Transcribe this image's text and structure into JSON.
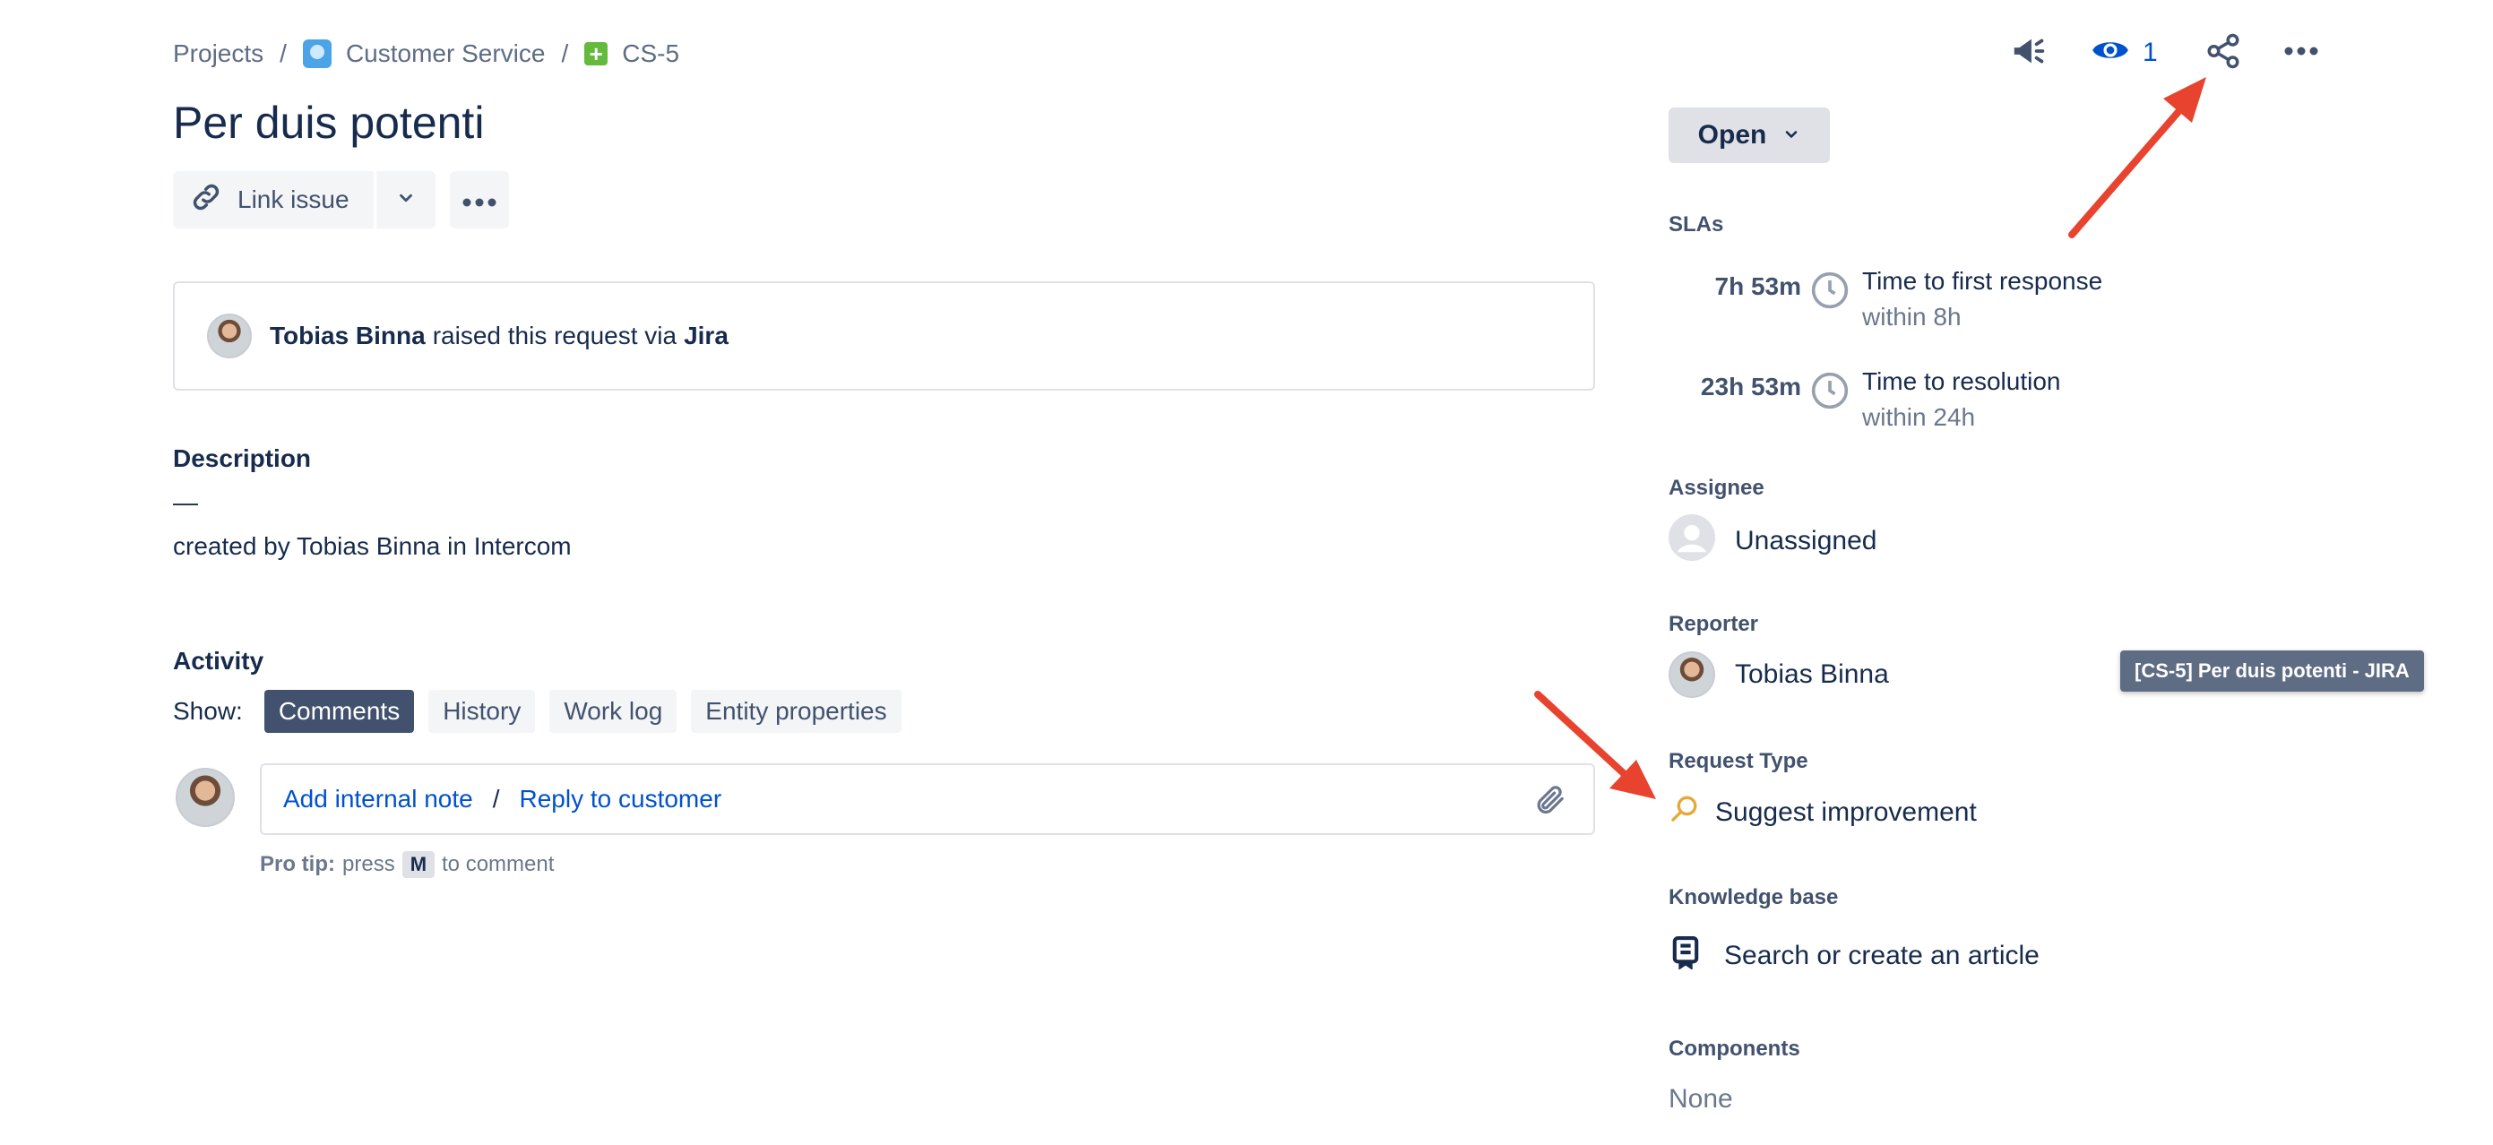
{
  "breadcrumb": {
    "projects": "Projects",
    "separator": "/",
    "project_name": "Customer Service",
    "issue_key": "CS-5"
  },
  "issue": {
    "title": "Per duis potenti"
  },
  "toolbar": {
    "link_issue_label": "Link issue"
  },
  "raised": {
    "reporter_name": "Tobias Binna",
    "middle_text": "raised this request via",
    "channel": "Jira"
  },
  "description": {
    "label": "Description",
    "dash": "—",
    "text": "created by Tobias Binna in Intercom"
  },
  "activity": {
    "label": "Activity",
    "show_label": "Show:",
    "tabs": [
      {
        "label": "Comments",
        "active": true
      },
      {
        "label": "History",
        "active": false
      },
      {
        "label": "Work log",
        "active": false
      },
      {
        "label": "Entity properties",
        "active": false
      }
    ],
    "add_internal_note": "Add internal note",
    "slash": "/",
    "reply_to_customer": "Reply to customer",
    "protip_label": "Pro tip:",
    "protip_press": "press",
    "protip_key": "M",
    "protip_tail": "to comment"
  },
  "header": {
    "watchers_count": "1",
    "icons": [
      "megaphone-icon",
      "eye-icon",
      "share-icon",
      "more-icon"
    ]
  },
  "status": {
    "label": "Open"
  },
  "slas": {
    "label": "SLAs",
    "items": [
      {
        "remaining": "7h 53m",
        "name": "Time to first response",
        "goal": "within 8h"
      },
      {
        "remaining": "23h 53m",
        "name": "Time to resolution",
        "goal": "within 24h"
      }
    ]
  },
  "assignee": {
    "label": "Assignee",
    "value": "Unassigned"
  },
  "reporter": {
    "label": "Reporter",
    "value": "Tobias Binna"
  },
  "request_type": {
    "label": "Request Type",
    "value": "Suggest improvement"
  },
  "knowledge_base": {
    "label": "Knowledge base",
    "value": "Search or create an article"
  },
  "components": {
    "label": "Components",
    "value": "None"
  },
  "tooltip": {
    "text": "[CS-5] Per duis potenti - JIRA"
  },
  "colors": {
    "annotation_arrow": "#E8432E",
    "link": "#0052CC",
    "text": "#172B4D"
  }
}
